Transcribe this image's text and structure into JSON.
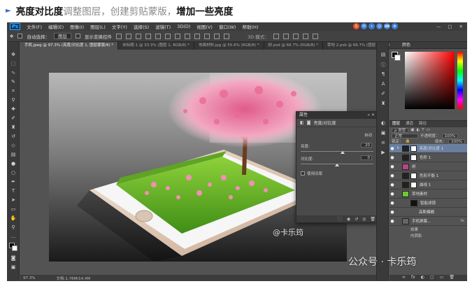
{
  "caption": {
    "arrow": "►",
    "part1": "亮度对比度",
    "part2": "调整图层，创建剪贴蒙版，",
    "part3": "增加一些亮度"
  },
  "menubar": {
    "logo": "Ps",
    "items": [
      "文件(F)",
      "编辑(E)",
      "图像(I)",
      "图层(L)",
      "文字(Y)",
      "选择(S)",
      "滤镜(T)",
      "3D(D)",
      "视图(V)",
      "窗口(W)",
      "帮助(H)"
    ],
    "win": [
      "—",
      "□",
      "✕"
    ],
    "sogou": [
      "S",
      "中",
      "•",
      "☺",
      "⌨",
      "⚙"
    ]
  },
  "options": {
    "autoselect_label": "自动选择：",
    "autoselect_value": "图层",
    "transform_label": "显示变换控件",
    "mode3d": "3D 模式："
  },
  "tabs": [
    {
      "label": "手机.jpeg @ 97.3% (亮度/对比度 1, 图层蒙版/8) *",
      "active": true
    },
    {
      "label": "未标题-1 @ 33.3% (图层 1, RGB/8) *",
      "active": false
    },
    {
      "label": "地面材料.jpg @ 55.6% (RGB/8) *",
      "active": false
    },
    {
      "label": "树.psd @ 66.7% (RGB/8) *",
      "active": false
    },
    {
      "label": "草地 2.psb @ 66.7% (图层 0, RGB/8) *",
      "active": false
    }
  ],
  "statusbar": {
    "zoom": "97.3%",
    "doc": "文档:1.76M/14.4M"
  },
  "color_panel": {
    "title": "颜色",
    "swatch_fg": "#000000",
    "swatch_bg": "#ffffff"
  },
  "layers_panel": {
    "tabs": [
      "图层",
      "通道",
      "路径"
    ],
    "kind_label": "ρ 类型",
    "blend_mode": "正常",
    "opacity_label": "不透明度：",
    "opacity_value": "100%",
    "lock_label": "锁定：",
    "fill_label": "填充：",
    "fill_value": "100%",
    "layers": [
      {
        "name": "亮度/对比度 1",
        "selected": true,
        "fx": ""
      },
      {
        "name": "色阶 1",
        "selected": false,
        "fx": ""
      },
      {
        "name": "树",
        "selected": false,
        "fx": ""
      },
      {
        "name": "色彩平衡 1",
        "selected": false,
        "fx": ""
      },
      {
        "name": "曲线 1",
        "selected": false,
        "fx": ""
      },
      {
        "name": "草地素材",
        "selected": false,
        "fx": ""
      },
      {
        "name": "智能滤镜",
        "selected": false,
        "fx": ""
      },
      {
        "name": "高斯模糊",
        "selected": false,
        "fx": ""
      },
      {
        "name": "手机屏幕...",
        "selected": false,
        "fx": "fx"
      }
    ],
    "sub": [
      "效果",
      "内阴影"
    ],
    "footer": [
      "∞",
      "fx",
      "◐",
      "▢",
      "▭",
      "🗑"
    ]
  },
  "properties": {
    "title": "属性",
    "close": "»  ✕",
    "type_label": "亮度/对比度",
    "auto_button": "自动",
    "brightness_label": "亮度:",
    "brightness_value": 20,
    "contrast_label": "对比度:",
    "contrast_value": 0,
    "legacy_label": "使用旧版",
    "brightness_fraction": 0.58,
    "contrast_fraction": 0.5,
    "footer": [
      "⬛",
      "◉",
      "↺",
      "◎",
      "🗑"
    ]
  },
  "watermark": {
    "small": "@卡乐筠",
    "big": "公众号 · 卡乐筠"
  }
}
